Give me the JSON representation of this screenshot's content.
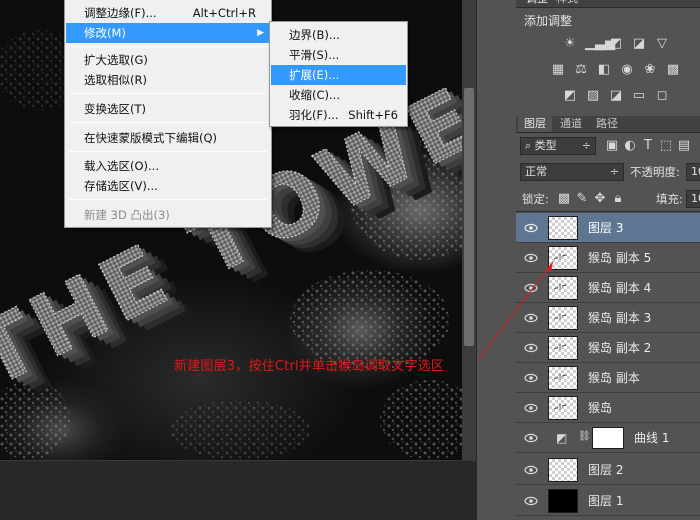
{
  "main_menu": {
    "items": [
      {
        "label": "调整边缘(F)...",
        "shortcut": "Alt+Ctrl+R"
      },
      {
        "label": "修改(M)",
        "selected": true,
        "submenu": true
      },
      {
        "label": "扩大选取(G)"
      },
      {
        "label": "选取相似(R)"
      },
      {
        "label": "变换选区(T)"
      },
      {
        "label": "在快速蒙版模式下编辑(Q)"
      },
      {
        "label": "载入选区(O)..."
      },
      {
        "label": "存储选区(V)..."
      },
      {
        "label": "新建 3D 凸出(3)",
        "disabled": true
      }
    ]
  },
  "sub_menu": {
    "items": [
      {
        "label": "边界(B)..."
      },
      {
        "label": "平滑(S)..."
      },
      {
        "label": "扩展(E)...",
        "selected": true
      },
      {
        "label": "收缩(C)..."
      },
      {
        "label": "羽化(F)...",
        "shortcut": "Shift+F6"
      }
    ]
  },
  "canvas": {
    "artwork_text": "THE TOWER"
  },
  "adjustments_panel": {
    "tabs": [
      "调整",
      "样式"
    ],
    "title": "添加调整",
    "icons": [
      "brightness-icon",
      "levels-icon",
      "curves-icon",
      "exposure-icon",
      "vibrance-icon",
      "color-balance-icon",
      "black-white-icon",
      "photo-filter-icon",
      "channel-mixer-icon",
      "color-lookup-icon",
      "invert-icon",
      "posterize-icon",
      "threshold-icon",
      "selective-color-icon"
    ]
  },
  "layers_panel": {
    "tabs": [
      "图层",
      "通道",
      "路径"
    ],
    "filter_label": "类型",
    "blend_mode": "正常",
    "opacity_label": "不透明度:",
    "opacity_value": "10",
    "lock_label": "锁定:",
    "fill_label": "填充:",
    "fill_value": "10",
    "layers": [
      {
        "name": "图层 3",
        "thumb": "transparent",
        "selected": true
      },
      {
        "name": "猴岛 副本 5",
        "thumb": "text"
      },
      {
        "name": "猴岛 副本 4",
        "thumb": "text"
      },
      {
        "name": "猴岛 副本 3",
        "thumb": "text"
      },
      {
        "name": "猴岛 副本 2",
        "thumb": "text"
      },
      {
        "name": "猴岛 副本",
        "thumb": "text"
      },
      {
        "name": "猴岛",
        "thumb": "text"
      },
      {
        "name": "曲线 1",
        "thumb": "adjustment"
      },
      {
        "name": "图层 2",
        "thumb": "transparent"
      },
      {
        "name": "图层 1",
        "thumb": "black"
      }
    ]
  },
  "annotation": {
    "text": "新建图层3，按住Ctrl并单击猴岛调取文字选区",
    "color": "#e01818"
  },
  "colors": {
    "menu_highlight": "#3399ff",
    "selected_layer": "#5e7692",
    "panel_bg": "#535353"
  }
}
